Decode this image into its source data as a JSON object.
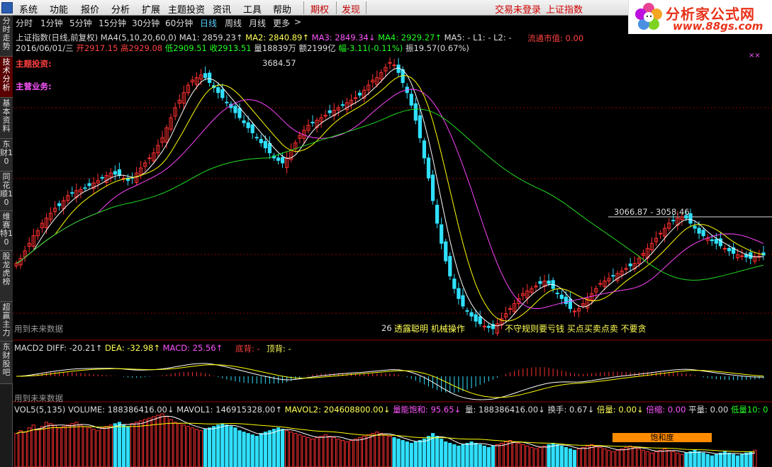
{
  "menu": {
    "items": [
      "系统",
      "功能",
      "报价",
      "分析",
      "扩展",
      "主题投资",
      "资讯",
      "工具",
      "帮助"
    ],
    "extra": [
      "期权",
      "发现"
    ],
    "login_status": "交易未登录",
    "index_name": "上证指数"
  },
  "logo": {
    "title": "分析家公式网",
    "url": "www.88gs.com"
  },
  "side_tabs": [
    "分时走势",
    "技术分析",
    "基本资料",
    "东财10",
    "同花顺10",
    "维赛特10",
    "股龙虎榜",
    "超赢主力",
    "东财股吧"
  ],
  "periods": [
    "分时",
    "1分钟",
    "5分钟",
    "15分钟",
    "30分钟",
    "60分钟",
    "日线",
    "周线",
    "月线",
    "更多",
    ">"
  ],
  "active_period": "日线",
  "main": {
    "title": "上证指数(日线,前复权)",
    "ma_params": "MA4(5,10,20,60,0)",
    "ma1": "MA1: 2859.23↑",
    "ma2": "MA2: 2840.89↑",
    "ma3": "MA3: 2849.34↓",
    "ma4": "MA4: 2929.27↑",
    "ma5": "MA5: -",
    "l12": "L1: -  L2: -",
    "market_value": "流通市值: 0.00",
    "date_line": "2016/06/01/三",
    "open": "开2917.15",
    "high": "高2929.08",
    "low": "低2909.51",
    "close": "收2913.51",
    "vol_amt": "量18839万 额2199亿",
    "change": "幅-3.11(-0.11%)",
    "amp": "振19.57(0.67%)",
    "theme_label": "主题投资:",
    "business_label": "主营业务:",
    "peak_label": "3684.57",
    "range_label": "3066.87 - 3058.46",
    "low_label": "26",
    "note1": "透露聪明 机械操作",
    "note2": "不守规则要亏钱 买点买卖点卖 不要贪",
    "future_note": "用到未来数据",
    "close_mark": "××"
  },
  "macd": {
    "name": "MACD2",
    "diff": "DIFF: -20.21↑",
    "dea": "DEA: -32.98↑",
    "macd": "MACD: 25.56↑",
    "bottom": "底背: -",
    "top": "顶背: -",
    "future_note": "用到未来数据"
  },
  "vol": {
    "name": "VOL5(5,135)",
    "volume": "VOLUME: 188386416.00↓",
    "mavol1": "MAVOL1: 146915328.00↑",
    "mavol2": "MAVOL2: 204608800.00↓",
    "energy": "量能饱和: 95.65↓",
    "liang": "量: 188386416.00↓",
    "turnover": "换手: 0.67↓",
    "times": "倍量: 0.00↓",
    "shrink": "倍缩: 0.00",
    "flat": "平量: 0.00",
    "lowvol": "低量10: 0",
    "saturation_label": "饱和度"
  },
  "colors": {
    "up": "#ff3030",
    "down": "#30e0ff",
    "ma5": "#ffffff",
    "ma10": "#ffff00",
    "ma20": "#ff44ff",
    "ma60": "#22dd22",
    "grid": "#8b0000"
  },
  "series": {
    "closes": [
      2880,
      2900,
      2930,
      2960,
      2990,
      3010,
      3040,
      3060,
      3080,
      3100,
      3110,
      3130,
      3150,
      3160,
      3170,
      3175,
      3180,
      3190,
      3200,
      3210,
      3220,
      3230,
      3240,
      3235,
      3230,
      3220,
      3210,
      3220,
      3240,
      3260,
      3280,
      3300,
      3320,
      3350,
      3380,
      3420,
      3460,
      3500,
      3530,
      3560,
      3590,
      3610,
      3620,
      3630,
      3620,
      3600,
      3580,
      3560,
      3540,
      3520,
      3500,
      3480,
      3460,
      3440,
      3420,
      3400,
      3380,
      3360,
      3340,
      3320,
      3300,
      3290,
      3280,
      3300,
      3330,
      3360,
      3390,
      3410,
      3430,
      3440,
      3450,
      3460,
      3470,
      3480,
      3490,
      3500,
      3510,
      3520,
      3530,
      3540,
      3550,
      3570,
      3590,
      3610,
      3620,
      3640,
      3660,
      3680,
      3670,
      3640,
      3600,
      3560,
      3510,
      3450,
      3380,
      3300,
      3220,
      3130,
      3040,
      2960,
      2890,
      2830,
      2780,
      2740,
      2710,
      2690,
      2670,
      2650,
      2640,
      2630,
      2625,
      2620,
      2640,
      2660,
      2680,
      2700,
      2720,
      2740,
      2760,
      2770,
      2780,
      2790,
      2800,
      2810,
      2800,
      2780,
      2760,
      2740,
      2720,
      2700,
      2690,
      2700,
      2720,
      2740,
      2760,
      2780,
      2800,
      2810,
      2820,
      2830,
      2840,
      2850,
      2860,
      2870,
      2880,
      2900,
      2920,
      2940,
      2960,
      2980,
      3000,
      3020,
      3040,
      3050,
      3060,
      3065,
      3060,
      3040,
      3020,
      3000,
      2990,
      2980,
      2970,
      2960,
      2950,
      2940,
      2930,
      2920,
      2915,
      2910,
      2905,
      2900,
      2905,
      2910,
      2913
    ],
    "volumes": [
      1.2,
      1.3,
      1.25,
      1.4,
      1.5,
      1.35,
      1.45,
      1.6,
      1.55,
      1.5,
      1.4,
      1.45,
      1.5,
      1.55,
      1.6,
      1.5,
      1.45,
      1.4,
      1.35,
      1.3,
      1.4,
      1.45,
      1.5,
      1.55,
      1.6,
      1.5,
      1.45,
      1.55,
      1.6,
      1.65,
      1.7,
      1.75,
      1.8,
      1.85,
      1.9,
      1.8,
      1.7,
      1.6,
      1.55,
      1.5,
      1.45,
      1.4,
      1.35,
      1.3,
      1.35,
      1.4,
      1.45,
      1.5,
      1.55,
      1.5,
      1.45,
      1.4,
      1.3,
      1.25,
      1.2,
      1.15,
      1.1,
      1.2,
      1.25,
      1.3,
      1.35,
      1.4,
      1.35,
      1.3,
      1.25,
      1.2,
      1.15,
      1.1,
      1.05,
      1.0,
      1.05,
      1.1,
      1.15,
      1.1,
      1.05,
      1.0,
      0.95,
      0.9,
      0.95,
      1.0,
      1.05,
      1.1,
      1.15,
      1.2,
      1.25,
      1.2,
      1.15,
      1.1,
      1.05,
      1.0,
      0.95,
      0.9,
      0.85,
      0.9,
      0.95,
      1.0,
      1.1,
      1.2,
      1.1,
      1.0,
      0.9,
      0.85,
      0.8,
      0.75,
      0.8,
      0.85,
      0.9,
      0.85,
      0.8,
      0.75,
      0.7,
      0.75,
      0.8,
      0.85,
      0.9,
      0.95,
      0.9,
      0.85,
      0.8,
      0.75,
      0.7,
      0.65,
      0.7,
      0.75,
      0.8,
      0.85,
      0.8,
      0.75,
      0.7,
      0.65,
      0.6,
      0.65,
      0.7,
      0.75,
      0.8,
      0.75,
      0.7,
      0.65,
      0.6,
      0.55,
      0.6,
      0.65,
      0.7,
      0.75,
      0.7,
      0.65,
      0.6,
      0.55,
      0.5,
      0.55,
      0.6,
      0.65,
      0.6,
      0.55,
      0.5,
      0.45,
      0.5,
      0.55,
      0.6,
      0.55,
      0.5,
      0.45,
      0.4,
      0.45,
      0.5,
      0.55,
      0.5,
      0.45,
      0.4,
      0.45,
      0.5,
      0.55,
      0.6
    ]
  }
}
